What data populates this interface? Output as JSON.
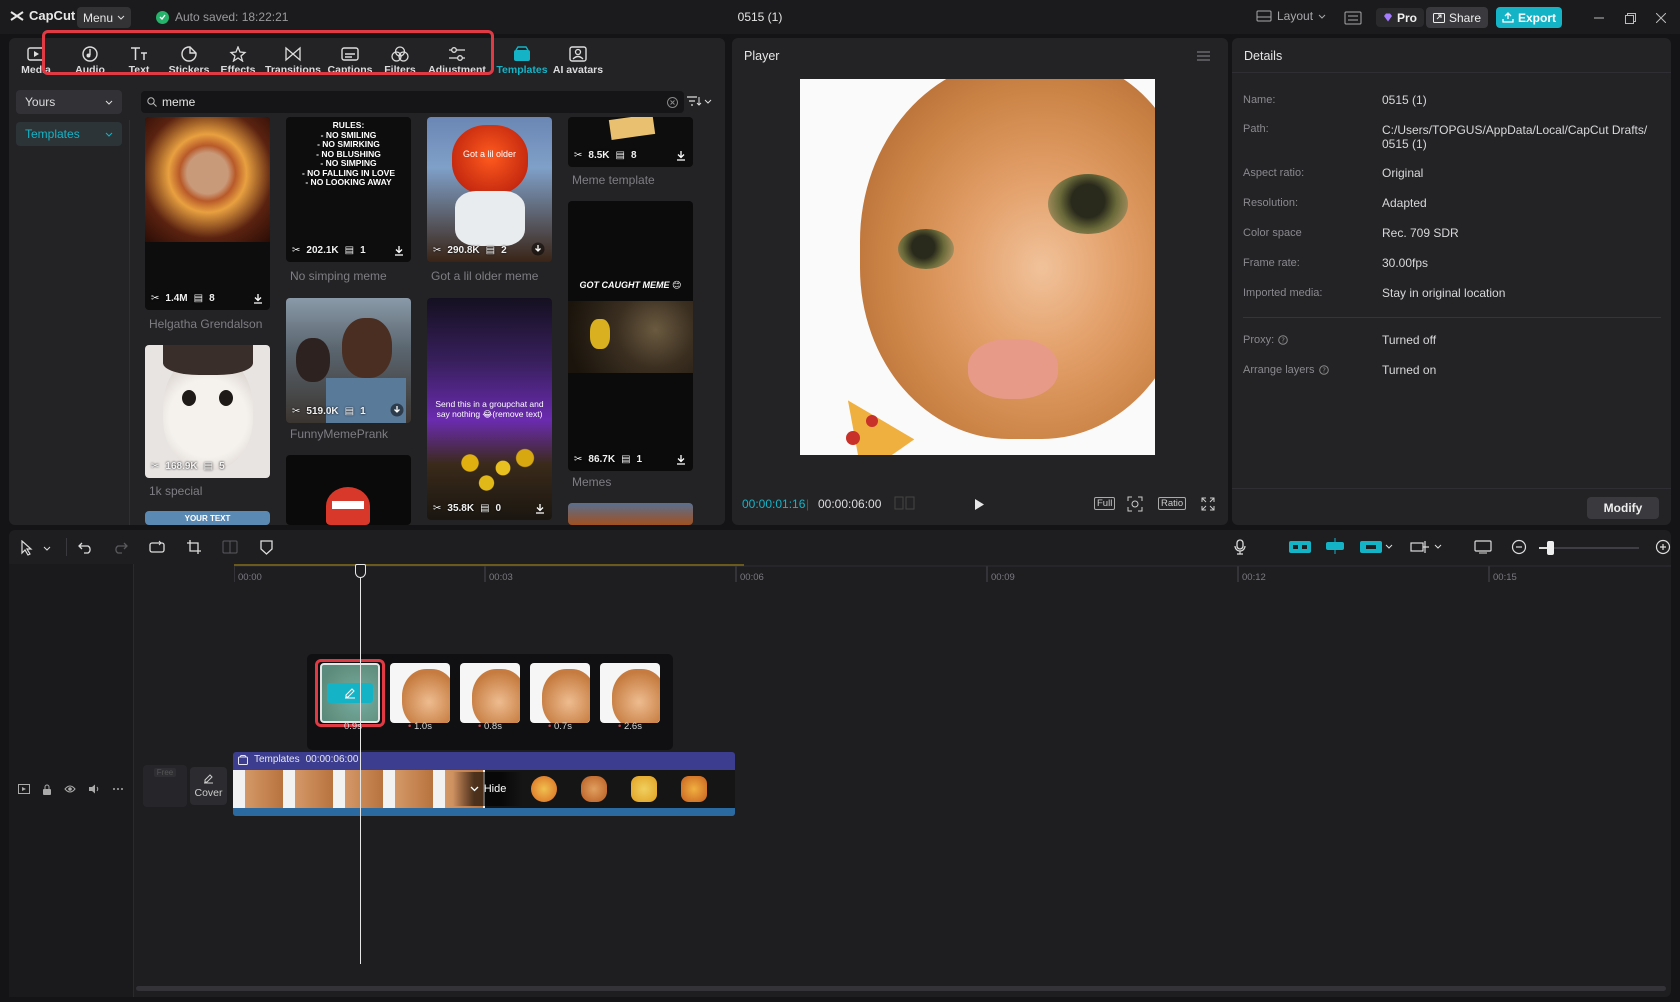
{
  "app": {
    "logo_text": "CapCut",
    "menu_label": "Menu",
    "autosave_text": "Auto saved: 18:22:21",
    "project_title": "0515 (1)",
    "layout_label": "Layout",
    "pro_label": "Pro",
    "share_label": "Share",
    "export_label": "Export"
  },
  "toolbar": {
    "tabs": [
      {
        "label": "Media",
        "icon": "media-icon"
      },
      {
        "label": "Audio",
        "icon": "audio-icon"
      },
      {
        "label": "Text",
        "icon": "text-icon"
      },
      {
        "label": "Stickers",
        "icon": "stickers-icon"
      },
      {
        "label": "Effects",
        "icon": "effects-icon"
      },
      {
        "label": "Transitions",
        "icon": "transitions-icon"
      },
      {
        "label": "Captions",
        "icon": "captions-icon"
      },
      {
        "label": "Filters",
        "icon": "filters-icon"
      },
      {
        "label": "Adjustment",
        "icon": "adjustment-icon"
      },
      {
        "label": "Templates",
        "icon": "templates-icon",
        "active": true
      },
      {
        "label": "AI avatars",
        "icon": "ai-avatars-icon"
      }
    ]
  },
  "media": {
    "sidebar": {
      "yours_label": "Yours",
      "templates_label": "Templates"
    },
    "search": {
      "value": "meme"
    },
    "cards": [
      {
        "caption": "Helgatha Grendalson",
        "uses": "1.4M",
        "clips": "8"
      },
      {
        "caption": "1k special",
        "uses": "168.9K",
        "clips": "5"
      },
      {
        "caption": "No simping meme",
        "uses": "202.1K",
        "clips": "1",
        "overlay_text": "RULES:\n- NO SMILING\n- NO SMIRKING\n- NO BLUSHING\n- NO SIMPING\n- NO FALLING IN LOVE\n- NO LOOKING AWAY"
      },
      {
        "caption": "FunnyMemePrank",
        "uses": "519.0K",
        "clips": "1"
      },
      {
        "caption": "Got a lil older meme",
        "uses": "290.8K",
        "clips": "2",
        "overlay_text": "Got a lil older"
      },
      {
        "caption": "",
        "uses": "35.8K",
        "clips": "0",
        "overlay_text": "Send this in a groupchat and say nothing 😂(remove text)"
      },
      {
        "caption": "Meme template",
        "uses": "8.5K",
        "clips": "8"
      },
      {
        "caption": "Memes",
        "uses": "86.7K",
        "clips": "1",
        "overlay_text": "GOT CAUGHT MEME 😊"
      }
    ],
    "partial_card_text": "YOUR TEXT"
  },
  "player": {
    "title": "Player",
    "current_time": "00:00:01:16",
    "total_time": "00:00:06:00",
    "full_label": "Full",
    "ratio_label": "Ratio"
  },
  "details": {
    "title": "Details",
    "rows": [
      {
        "label": "Name:",
        "value": "0515 (1)"
      },
      {
        "label": "Path:",
        "value": "C:/Users/TOPGUS/AppData/Local/CapCut Drafts/ 0515 (1)"
      },
      {
        "label": "Aspect ratio:",
        "value": "Original"
      },
      {
        "label": "Resolution:",
        "value": "Adapted"
      },
      {
        "label": "Color space",
        "value": "Rec. 709 SDR"
      },
      {
        "label": "Frame rate:",
        "value": "30.00fps"
      },
      {
        "label": "Imported media:",
        "value": "Stay in original location"
      }
    ],
    "rows2": [
      {
        "label": "Proxy:",
        "value": "Turned off"
      },
      {
        "label": "Arrange layers",
        "value": "Turned on"
      }
    ],
    "modify_label": "Modify"
  },
  "timeline": {
    "ruler": [
      "00:00",
      "00:03",
      "00:06",
      "00:09",
      "00:12",
      "00:15"
    ],
    "clips": [
      {
        "duration": "0.9s"
      },
      {
        "duration": "1.0s"
      },
      {
        "duration": "0.8s"
      },
      {
        "duration": "0.7s"
      },
      {
        "duration": "2.6s"
      }
    ],
    "track_label": "Templates",
    "track_duration": "00:00:06:00",
    "hide_label": "Hide",
    "cover_label": "Cover",
    "free_label": "Free"
  },
  "colors": {
    "accent": "#15b3c6",
    "highlight": "#e03b45",
    "track": "#3c3d8f"
  }
}
